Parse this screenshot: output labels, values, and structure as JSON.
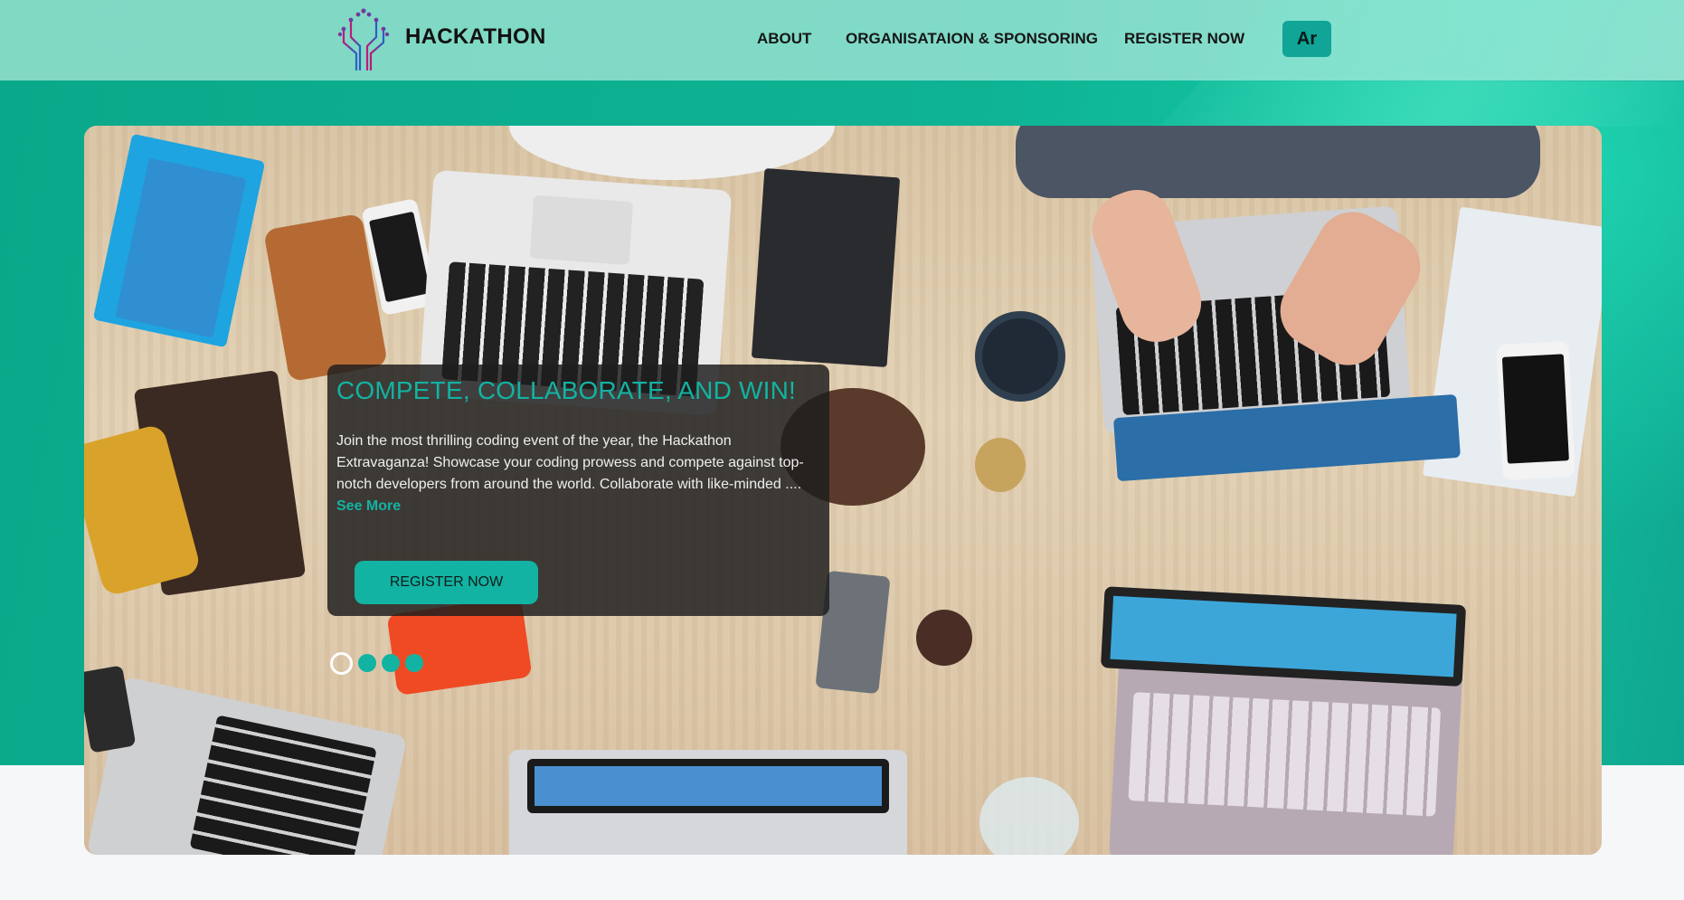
{
  "header": {
    "brand": "HACKATHON",
    "logo_icon": "circuit-tree-logo-icon",
    "nav": {
      "about": "ABOUT",
      "organisation": "ORGANISATAION & SPONSORING",
      "register": "REGISTER NOW"
    },
    "language_button": "Ar"
  },
  "hero": {
    "title": "COMPETE, COLLABORATE, AND WIN!",
    "description": "Join the most thrilling coding event of the year, the Hackathon Extravaganza! Showcase your coding prowess and compete against top-notch developers from around the world. Collaborate with like-minded ....",
    "see_more": "See More",
    "cta": "REGISTER NOW",
    "image_subject": "overhead view of desk with laptops",
    "carousel": {
      "slides": 4,
      "active_index": 0
    }
  },
  "colors": {
    "accent": "#12b3a2",
    "band": "#0eb394",
    "header": "#96e1cd",
    "card_bg": "#1e1e1e"
  }
}
